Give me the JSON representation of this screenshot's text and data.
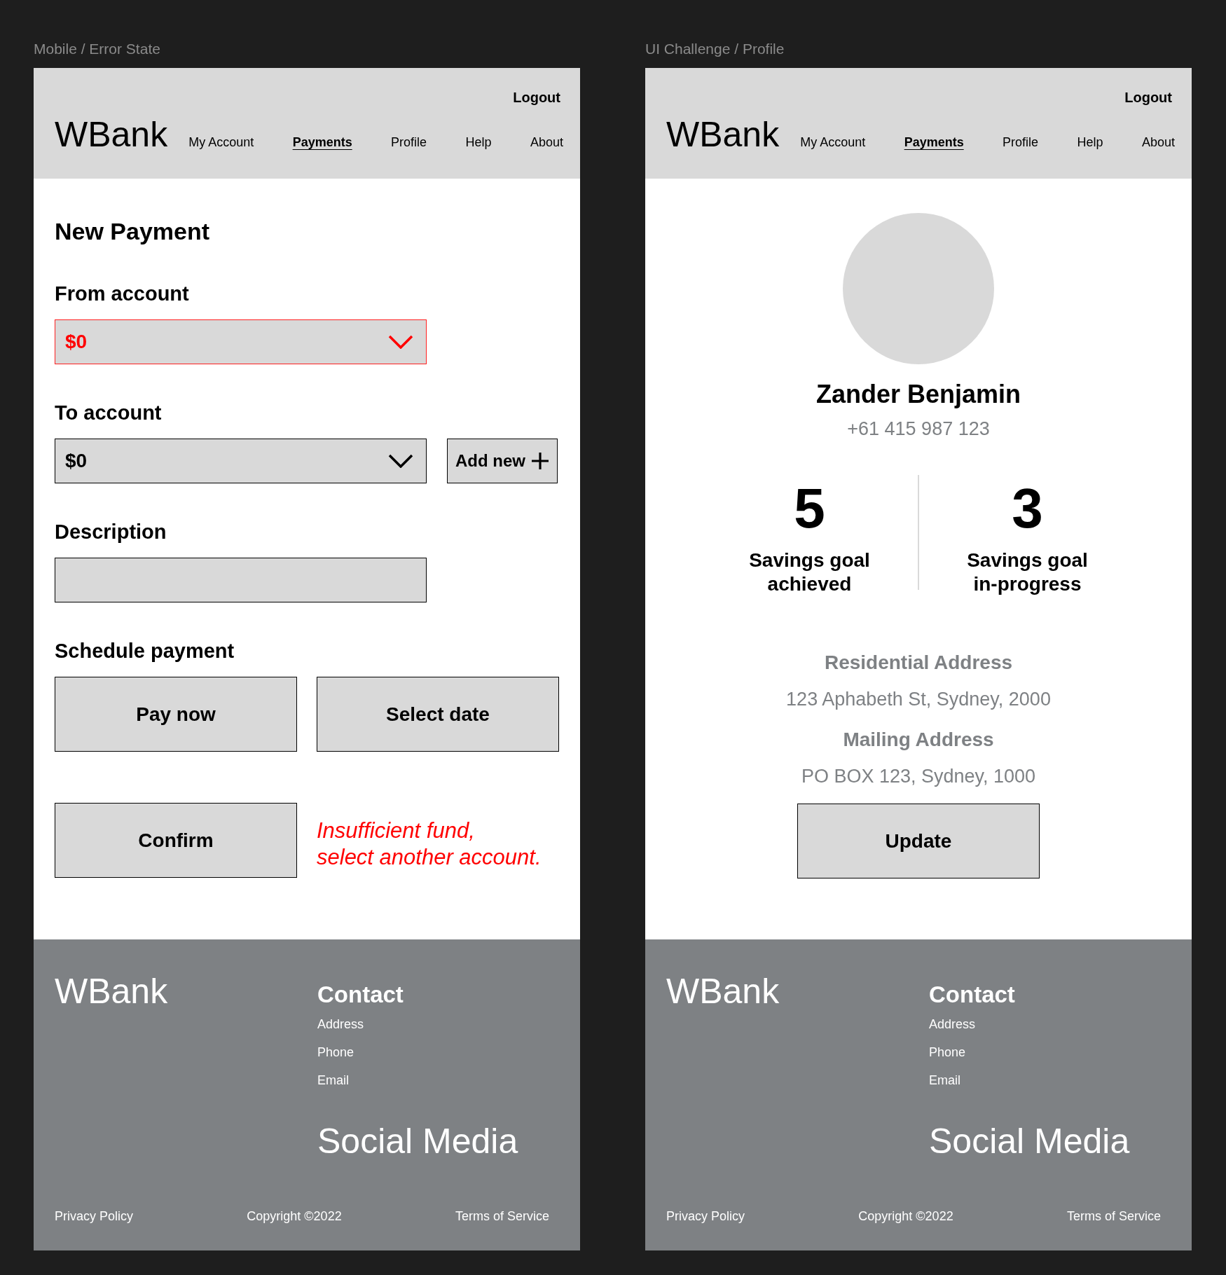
{
  "frames": [
    {
      "label": "Mobile / Error State",
      "kind": "payment",
      "header": {
        "logout": "Logout",
        "logo": "WBank",
        "nav": [
          {
            "label": "My Account",
            "selected": false
          },
          {
            "label": "Payments",
            "selected": true
          },
          {
            "label": "Profile",
            "selected": false
          },
          {
            "label": "Help",
            "selected": false
          },
          {
            "label": "About",
            "selected": false
          }
        ]
      },
      "content": {
        "title": "New Payment",
        "fields": [
          {
            "kind": "select",
            "label": "From account",
            "value": "$0",
            "error": true
          },
          {
            "kind": "select",
            "label": "To account",
            "value": "$0",
            "error": false,
            "action": "Add new"
          },
          {
            "kind": "text",
            "label": "Description"
          }
        ],
        "schedule": {
          "label": "Schedule payment",
          "options": [
            "Pay now",
            "Select date"
          ]
        },
        "confirm": "Confirm",
        "error_message": "Insufficient fund,\nselect another account."
      },
      "footer": {
        "logo": "WBank",
        "contact_heading": "Contact",
        "contact_items": [
          "Address",
          "Phone",
          "Email"
        ],
        "social_heading": "Social Media",
        "links": [
          "Privacy Policy",
          "Copyright ©2022",
          "Terms of Service"
        ]
      }
    },
    {
      "label": "UI Challenge / Profile",
      "kind": "profile",
      "header": {
        "logout": "Logout",
        "logo": "WBank",
        "nav": [
          {
            "label": "My Account",
            "selected": false
          },
          {
            "label": "Payments",
            "selected": true
          },
          {
            "label": "Profile",
            "selected": false
          },
          {
            "label": "Help",
            "selected": false
          },
          {
            "label": "About",
            "selected": false
          }
        ]
      },
      "content": {
        "name": "Zander Benjamin",
        "phone": "+61 415 987 123",
        "stats": [
          {
            "value": "5",
            "label": "Savings goal\nachieved"
          },
          {
            "value": "3",
            "label": "Savings goal\nin-progress"
          }
        ],
        "addresses": [
          {
            "heading": "Residential Address",
            "text": "123 Aphabeth St, Sydney, 2000"
          },
          {
            "heading": "Mailing Address",
            "text": "PO BOX 123, Sydney, 1000"
          }
        ],
        "button": "Update"
      },
      "footer": {
        "logo": "WBank",
        "contact_heading": "Contact",
        "contact_items": [
          "Address",
          "Phone",
          "Email"
        ],
        "social_heading": "Social Media",
        "links": [
          "Privacy Policy",
          "Copyright ©2022",
          "Terms of Service"
        ]
      }
    }
  ]
}
